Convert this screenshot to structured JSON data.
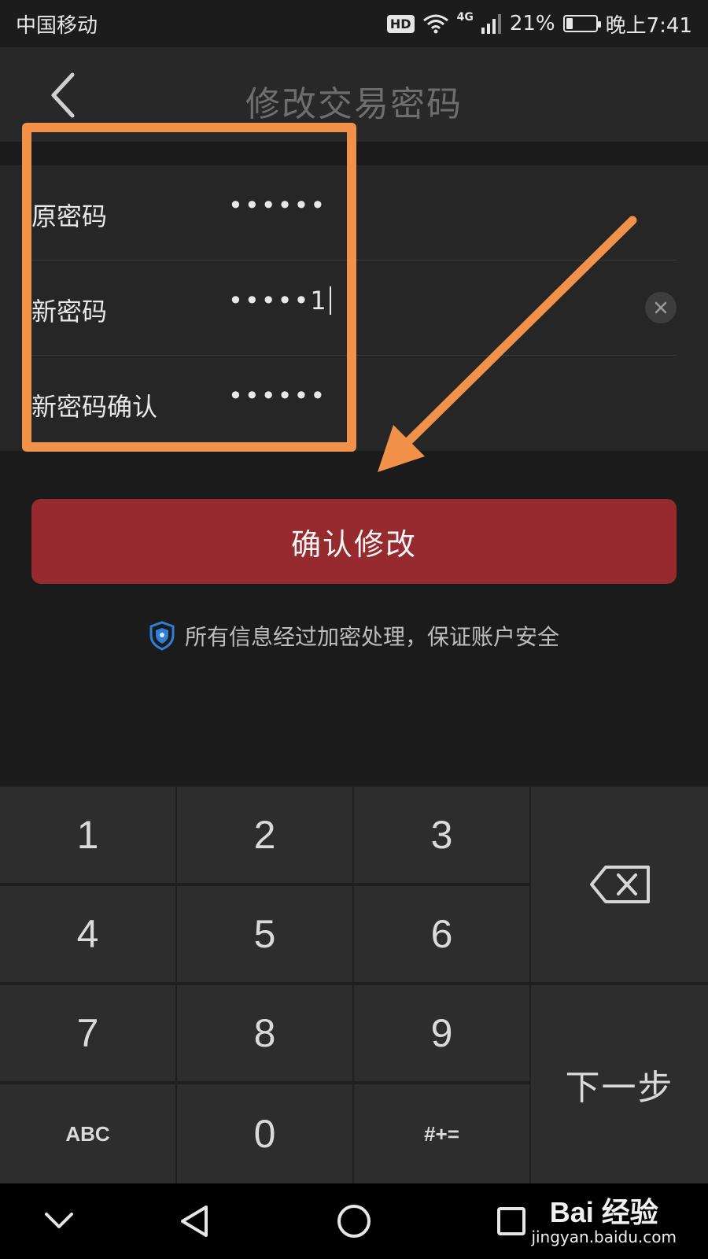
{
  "status_bar": {
    "carrier": "中国移动",
    "hd": "HD",
    "network": "4G",
    "battery_text": "21%",
    "battery_level": 0.21,
    "time": "晚上7:41"
  },
  "header": {
    "title": "修改交易密码",
    "back_icon": "chevron-left-icon"
  },
  "form": {
    "rows": [
      {
        "label": "原密码",
        "value": "••••••"
      },
      {
        "label": "新密码",
        "value": "•••••1",
        "focused": true
      },
      {
        "label": "新密码确认",
        "value": "••••••"
      }
    ],
    "clear_icon": "close-circle-icon"
  },
  "confirm_button": {
    "label": "确认修改"
  },
  "security_note": {
    "text": "所有信息经过加密处理，保证账户安全",
    "icon": "shield-icon"
  },
  "keypad": {
    "digits": [
      "1",
      "2",
      "3",
      "4",
      "5",
      "6",
      "7",
      "8",
      "9"
    ],
    "abc": "ABC",
    "zero": "0",
    "symbols": "#+=",
    "next": "下一步",
    "delete_icon": "backspace-icon"
  },
  "nav_bar": {
    "icons": [
      "chevron-down-icon",
      "back-triangle-icon",
      "home-circle-icon",
      "recents-square-icon"
    ]
  },
  "watermark": {
    "main": "Bai 经验",
    "sub": "jingyan.baidu.com"
  },
  "colors": {
    "accent_red": "#962a2e",
    "annotation_orange": "#f2924a",
    "background": "#1b1b1b"
  }
}
